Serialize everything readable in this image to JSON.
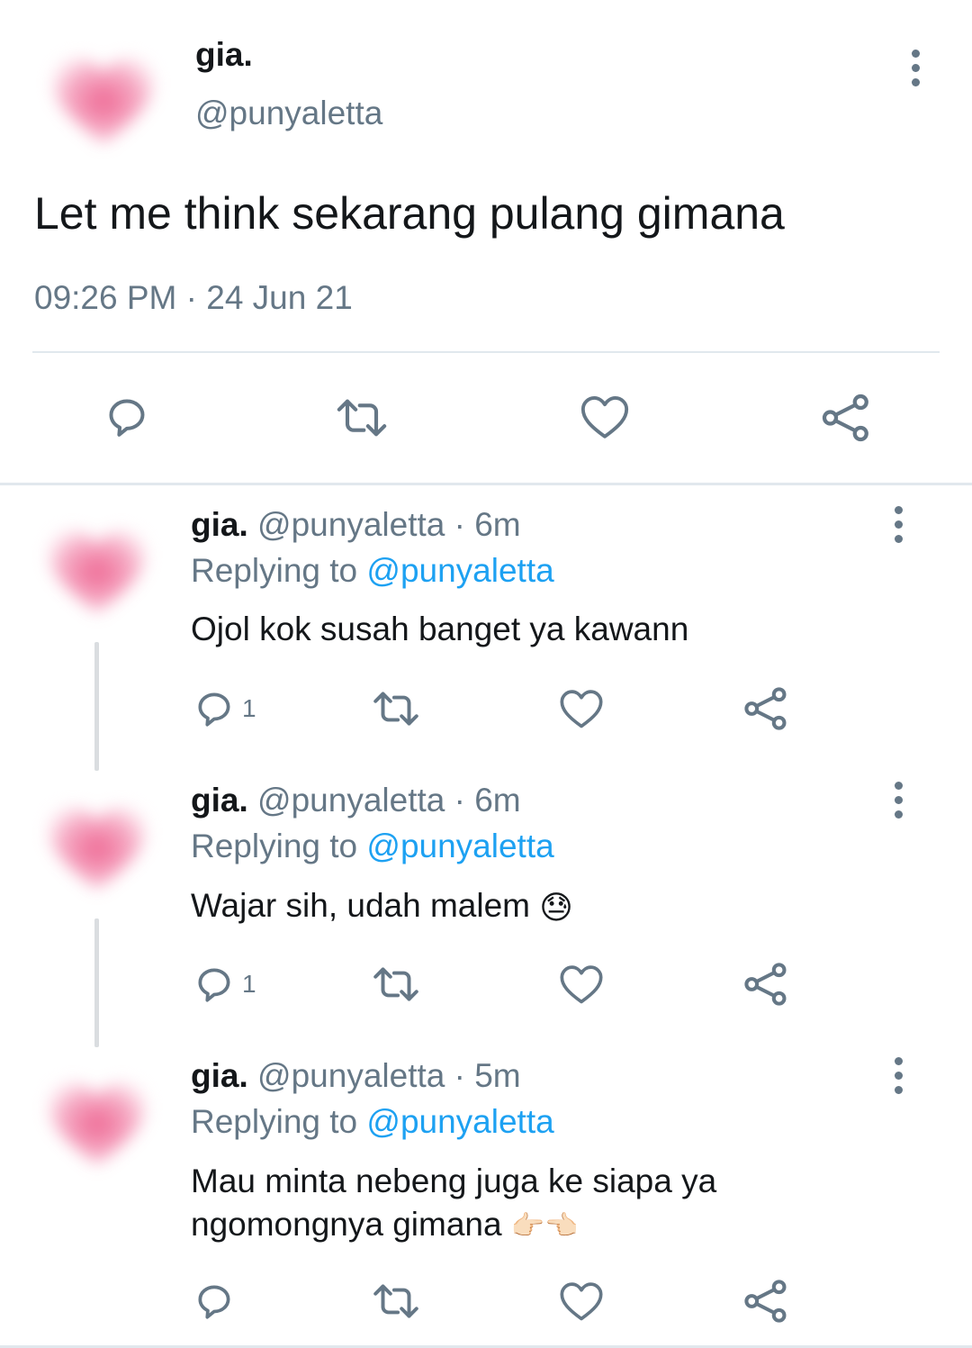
{
  "main_tweet": {
    "display_name": "gia.",
    "handle": "@punyaletta",
    "text": "Let me think sekarang pulang gimana",
    "timestamp": "09:26 PM · 24 Jun 21",
    "avatar_icon": "pink-heart-blurred-icon"
  },
  "replies": [
    {
      "display_name": "gia.",
      "handle": "@punyaletta",
      "time": "· 6m",
      "replying_prefix": "Replying to",
      "replying_handle": "@punyaletta",
      "text": "Ojol kok susah banget ya kawann",
      "reply_count": "1"
    },
    {
      "display_name": "gia.",
      "handle": "@punyaletta",
      "time": "· 6m",
      "replying_prefix": "Replying to",
      "replying_handle": "@punyaletta",
      "text": "Wajar sih, udah malem",
      "emoji": "😓",
      "reply_count": "1"
    },
    {
      "display_name": "gia.",
      "handle": "@punyaletta",
      "time": "· 5m",
      "replying_prefix": "Replying to",
      "replying_handle": "@punyaletta",
      "text_line1": "Mau minta nebeng juga ke siapa ya",
      "text_line2": "ngomongnya gimana",
      "emoji": "👉🏻👈🏻",
      "reply_count": ""
    }
  ],
  "colors": {
    "accent": "#1da1f2",
    "muted": "#657786",
    "heart": "#f06a93"
  }
}
